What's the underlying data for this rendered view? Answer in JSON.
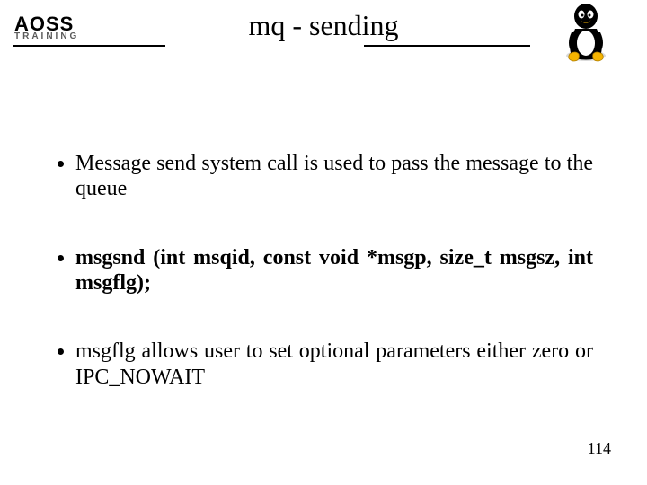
{
  "logo": {
    "line1": "AOSS",
    "line2": "TRAINING"
  },
  "title": "mq - sending",
  "mascot": "tux-icon",
  "bullets": [
    {
      "text": "Message send system call is used to pass the message to the queue",
      "bold": false
    },
    {
      "text": "msgsnd (int msqid, const void *msgp, size_t msgsz, int msgflg);",
      "bold": true
    },
    {
      "text": "msgflg allows user to set optional parameters either zero or IPC_NOWAIT",
      "bold": false
    }
  ],
  "page_number": "114"
}
